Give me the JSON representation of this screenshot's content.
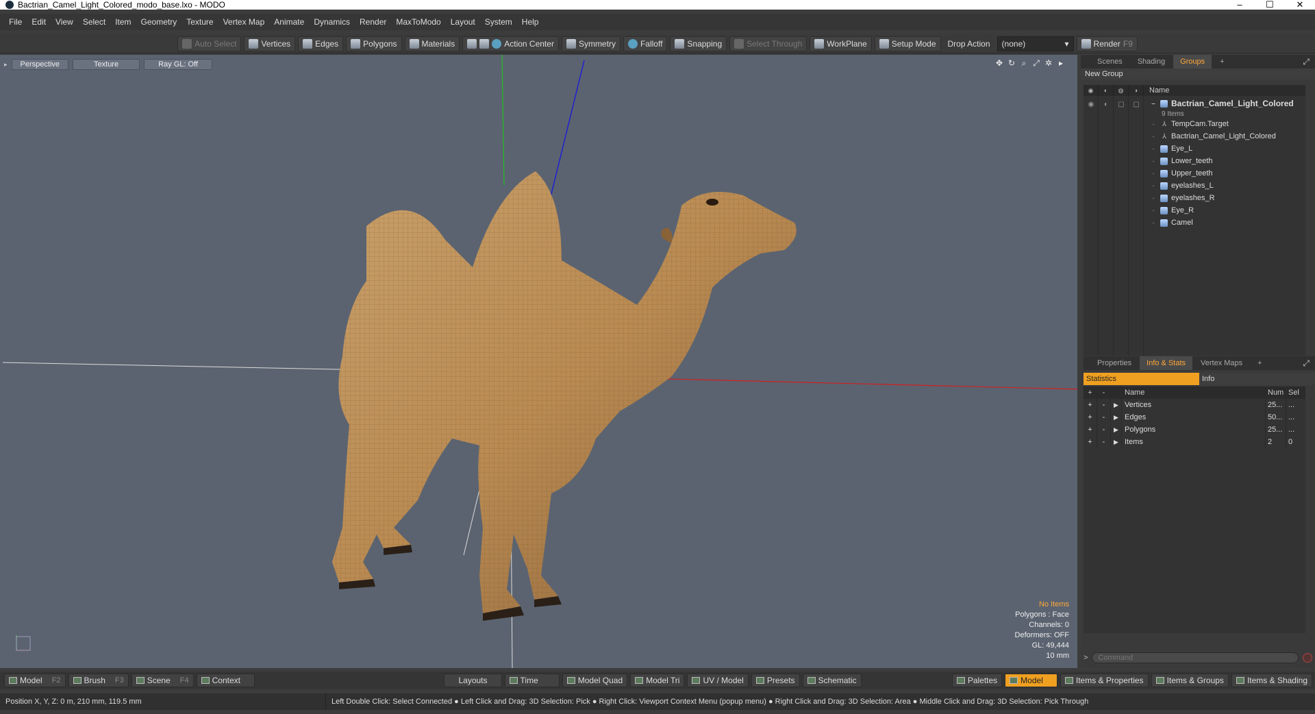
{
  "window": {
    "title": "Bactrian_Camel_Light_Colored_modo_base.lxo - MODO",
    "minimize": "–",
    "maximize": "☐",
    "close": "✕"
  },
  "menu": [
    "File",
    "Edit",
    "View",
    "Select",
    "Item",
    "Geometry",
    "Texture",
    "Vertex Map",
    "Animate",
    "Dynamics",
    "Render",
    "MaxToModo",
    "Layout",
    "System",
    "Help"
  ],
  "toolbar": {
    "auto_select": "Auto Select",
    "vertices": "Vertices",
    "edges": "Edges",
    "polygons": "Polygons",
    "materials": "Materials",
    "action_center": "Action Center",
    "symmetry": "Symmetry",
    "falloff": "Falloff",
    "snapping": "Snapping",
    "select_through": "Select Through",
    "workplane": "WorkPlane",
    "setup_mode": "Setup Mode",
    "drop_action": "Drop Action",
    "drop_action_value": "(none)",
    "render": "Render",
    "render_key": "F9"
  },
  "viewport": {
    "view_mode": "Perspective",
    "shading": "Texture",
    "raygl": "Ray GL: Off",
    "info": {
      "selection": "No Items",
      "polygons": "Polygons : Face",
      "channels": "Channels: 0",
      "deformers": "Deformers: OFF",
      "gl": "GL: 49,444",
      "grid": "10 mm"
    }
  },
  "groups_panel": {
    "tabs": [
      "Scenes",
      "Shading",
      "Groups"
    ],
    "active_tab": "Groups",
    "add": "+",
    "new_group": "New Group",
    "column_name": "Name",
    "root": {
      "name": "Bactrian_Camel_Light_Colored",
      "count": "9 Items"
    },
    "items": [
      {
        "name": "TempCam.Target",
        "icon": "locator-icon"
      },
      {
        "name": "Bactrian_Camel_Light_Colored",
        "icon": "locator-icon"
      },
      {
        "name": "Eye_L",
        "icon": "mesh-icon"
      },
      {
        "name": "Lower_teeth",
        "icon": "mesh-icon"
      },
      {
        "name": "Upper_teeth",
        "icon": "mesh-icon"
      },
      {
        "name": "eyelashes_L",
        "icon": "mesh-icon"
      },
      {
        "name": "eyelashes_R",
        "icon": "mesh-icon"
      },
      {
        "name": "Eye_R",
        "icon": "mesh-icon"
      },
      {
        "name": "Camel",
        "icon": "mesh-icon"
      }
    ]
  },
  "stats_panel": {
    "tabs": [
      "Properties",
      "Info & Stats",
      "Vertex Maps"
    ],
    "active_tab": "Info & Stats",
    "add": "+",
    "subtabs": [
      "Statistics",
      "Info"
    ],
    "columns": {
      "plus": "+",
      "minus": "-",
      "name": "Name",
      "num": "Num",
      "sel": "Sel"
    },
    "rows": [
      {
        "name": "Vertices",
        "num": "25...",
        "sel": "..."
      },
      {
        "name": "Edges",
        "num": "50...",
        "sel": "..."
      },
      {
        "name": "Polygons",
        "num": "25...",
        "sel": "..."
      },
      {
        "name": "Items",
        "num": "2",
        "sel": "0"
      }
    ],
    "command_placeholder": "Command"
  },
  "bottom_tabs": {
    "left": [
      {
        "label": "Model",
        "key": "F2"
      },
      {
        "label": "Brush",
        "key": "F3"
      },
      {
        "label": "Scene",
        "key": "F4"
      },
      {
        "label": "Context",
        "key": ""
      }
    ],
    "center": [
      "Layouts",
      "Time",
      "Model Quad",
      "Model Tri",
      "UV / Model",
      "Presets",
      "Schematic"
    ],
    "right": [
      "Palettes",
      "Model",
      "Items & Properties",
      "Items & Groups",
      "Items & Shading"
    ],
    "right_active": "Model"
  },
  "statusbar": {
    "position": "Position X, Y, Z:  0 m, 210 mm, 119.5 mm",
    "hint": "Left Double Click: Select Connected ● Left Click and Drag: 3D Selection: Pick ● Right Click: Viewport Context Menu (popup menu) ● Right Click and Drag: 3D Selection: Area ● Middle Click and Drag: 3D Selection: Pick Through"
  },
  "colors": {
    "accent": "#f0a020",
    "viewport_bg": "#5b6370",
    "axis_x": "#d02020",
    "axis_y": "#20c020",
    "axis_z": "#2020d0"
  }
}
